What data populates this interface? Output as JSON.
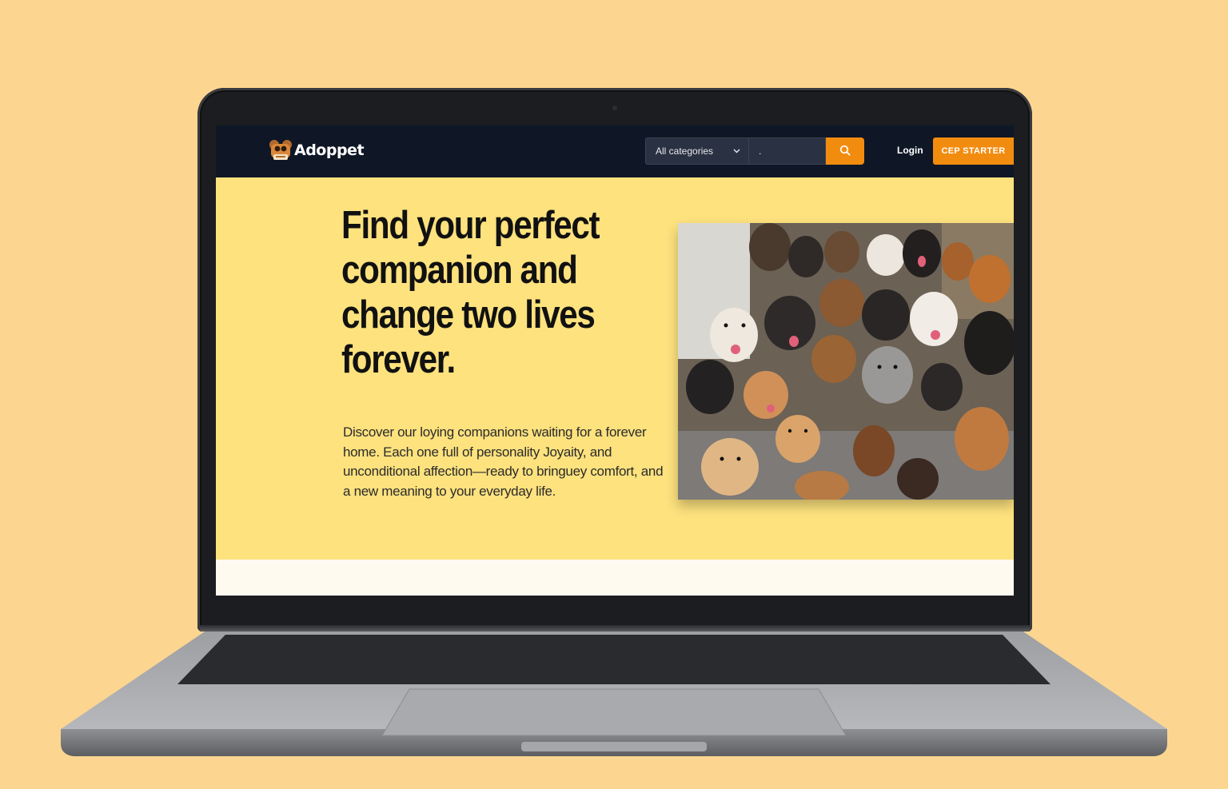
{
  "site": {
    "brand": "Adoppet"
  },
  "navbar": {
    "category_label": "All categories",
    "search_value": ".",
    "login_label": "Login",
    "cta_label": "CEP STARTER"
  },
  "hero": {
    "title": "Find your perfect companion and change two lives forever.",
    "description": "Discover our loying companions waiting for a forever home. Each one full of personality Joyaity, and unconditional affection—ready to bringuey comfort, and a new meaning to your everyday life.",
    "image_subject": "group of adoptable dogs"
  },
  "colors": {
    "page_background": "#fcd690",
    "navbar": "#0f1726",
    "accent": "#f28c0f",
    "hero_background": "#fde27e",
    "text_dark": "#111111"
  },
  "icons": {
    "logo": "dog-face-icon",
    "category_dropdown": "chevron-down-icon",
    "search": "search-icon"
  }
}
